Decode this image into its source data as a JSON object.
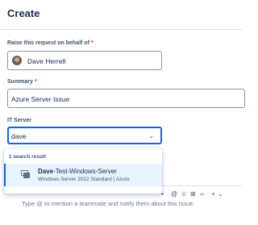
{
  "header": {
    "title": "Create"
  },
  "on_behalf": {
    "label": "Raise this request on behalf of",
    "required_mark": "*",
    "value": "Dave Herrell"
  },
  "summary": {
    "label": "Summary",
    "required_mark": "*",
    "value": "Azure Server Issue"
  },
  "it_server": {
    "label": "IT Server",
    "query": "dave",
    "results_header": "1 search result",
    "results": [
      {
        "title_bold": "Dave",
        "title_rest": "-Test-Windows-Server",
        "subtitle": "Windows Server 2022 Standard | Azure"
      }
    ]
  },
  "editor": {
    "placeholder": "Type @ to mention a teammate and notify them about this issue.",
    "toolbar": [
      "▪",
      "@",
      "☺",
      "⊞",
      "‹›",
      "+",
      "⌄"
    ]
  }
}
